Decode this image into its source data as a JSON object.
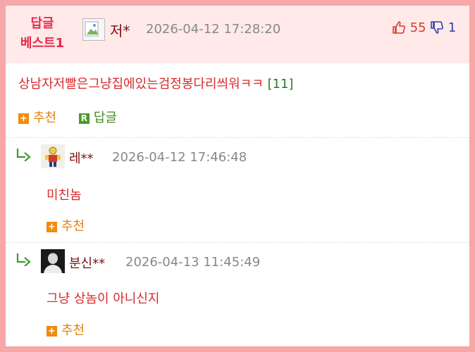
{
  "best": {
    "label_line1": "답글",
    "label_line2": "베스트1",
    "author": "저*",
    "date": "2026-04-12 17:28:20",
    "likes": "55",
    "dislikes": "1",
    "text": "상남자저빨은그냥집에있는검정봉다리씌워ㅋㅋ",
    "reply_count": "[11]",
    "recommend_label": "추천",
    "reply_label": "답글"
  },
  "comments": [
    {
      "author": "레**",
      "date": "2026-04-12 17:46:48",
      "text": "미친놈",
      "recommend_label": "추천"
    },
    {
      "author": "분신**",
      "date": "2026-04-13 11:45:49",
      "text": "그냥 상놈이 아니신지",
      "recommend_label": "추천"
    }
  ],
  "colors": {
    "accent_red": "#e8294a",
    "recommend_orange": "#f28a0a",
    "reply_green": "#4a9a2a"
  }
}
